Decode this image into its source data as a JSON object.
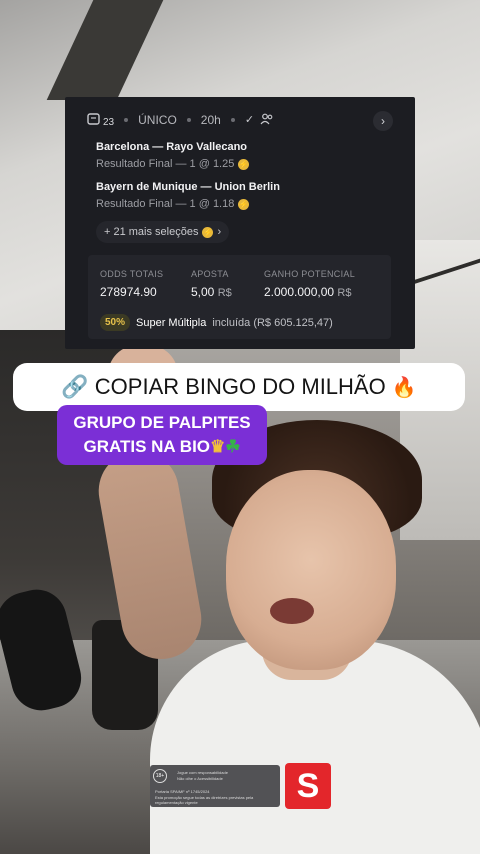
{
  "bet_card": {
    "selection_count": "23",
    "bet_type": "ÚNICO",
    "time": "20h",
    "matches": [
      {
        "name": "Barcelona — Rayo Vallecano",
        "detail": "Resultado Final — 1 @ 1.25"
      },
      {
        "name": "Bayern de Munique — Union Berlin",
        "detail": "Resultado Final — 1 @ 1.18"
      }
    ],
    "more_selections": "+ 21 mais seleções",
    "stats": {
      "odds_label": "ODDS TOTAIS",
      "odds_value": "278974.90",
      "stake_label": "APOSTA",
      "stake_value": "5,00",
      "stake_currency": "R$",
      "payout_label": "GANHO POTENCIAL",
      "payout_value": "2.000.000,00",
      "payout_currency": "R$"
    },
    "promo": {
      "percent": "50%",
      "name": "Super Múltipla",
      "text": "incluída (R$ 605.125,47)"
    }
  },
  "copy_bar": {
    "text": "COPIAR BINGO DO MILHÃO"
  },
  "group_sticker": {
    "line1": "GRUPO DE PALPITES",
    "line2": "GRATIS NA BIO"
  },
  "sponsor": {
    "age": "18+",
    "line1": "Jogue com responsabilidade",
    "line2": "Não olhe o Acessibilidade",
    "line3": "Portaria SPA/MF nº 1745/2024",
    "line4": "Esta promoção segue todas as diretrizes previstas pela regulamentação vigente",
    "logo": "S"
  },
  "icons": {
    "link": "link-icon",
    "fire": "fire-icon",
    "crown": "crown-icon",
    "clover": "clover-icon"
  }
}
